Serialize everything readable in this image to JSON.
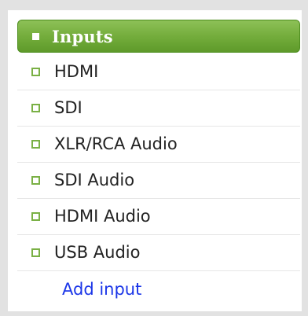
{
  "panel": {
    "title": "Inputs",
    "items": [
      {
        "label": "HDMI"
      },
      {
        "label": "SDI"
      },
      {
        "label": "XLR/RCA Audio"
      },
      {
        "label": "SDI Audio"
      },
      {
        "label": "HDMI Audio"
      },
      {
        "label": "USB Audio"
      }
    ],
    "add_link": "Add input"
  },
  "colors": {
    "header_green": "#74ad3c",
    "bullet_green": "#7ab045",
    "link_blue": "#1a35e8",
    "background": "#e2e2e2"
  },
  "icons": {
    "header_bullet": "square-bullet-icon",
    "item_bullet": "hollow-square-bullet-icon"
  }
}
